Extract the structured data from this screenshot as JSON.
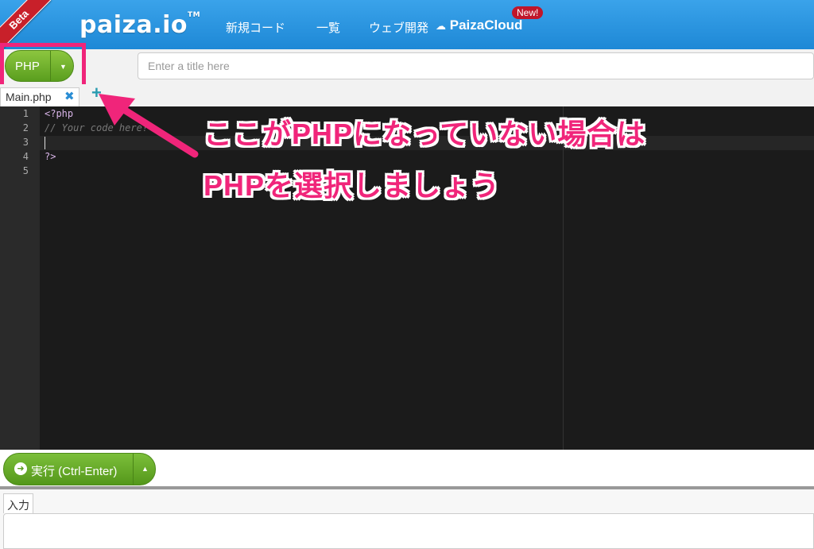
{
  "header": {
    "beta": "Beta",
    "logo": "paiza.io",
    "logo_tm": "TM",
    "nav": [
      "新規コード",
      "一覧",
      "ウェブ開発"
    ],
    "cloud": "PaizaCloud",
    "new_badge": "New!"
  },
  "toolbar": {
    "language": "PHP",
    "title_placeholder": "Enter a title here"
  },
  "tabs": [
    {
      "label": "Main.php",
      "close": "✖"
    }
  ],
  "add_tab": "+",
  "editor": {
    "line_numbers": [
      "1",
      "2",
      "3",
      "4",
      "5"
    ],
    "lines": [
      "<?php",
      "// Your code here!",
      "",
      "?>",
      ""
    ]
  },
  "annotation": {
    "line1": "ここがPHPになっていない場合は",
    "line2": "PHPを選択しましょう",
    "color": "#f0257a"
  },
  "run": {
    "label": "実行 (Ctrl-Enter)"
  },
  "io": {
    "input_tab": "入力"
  }
}
